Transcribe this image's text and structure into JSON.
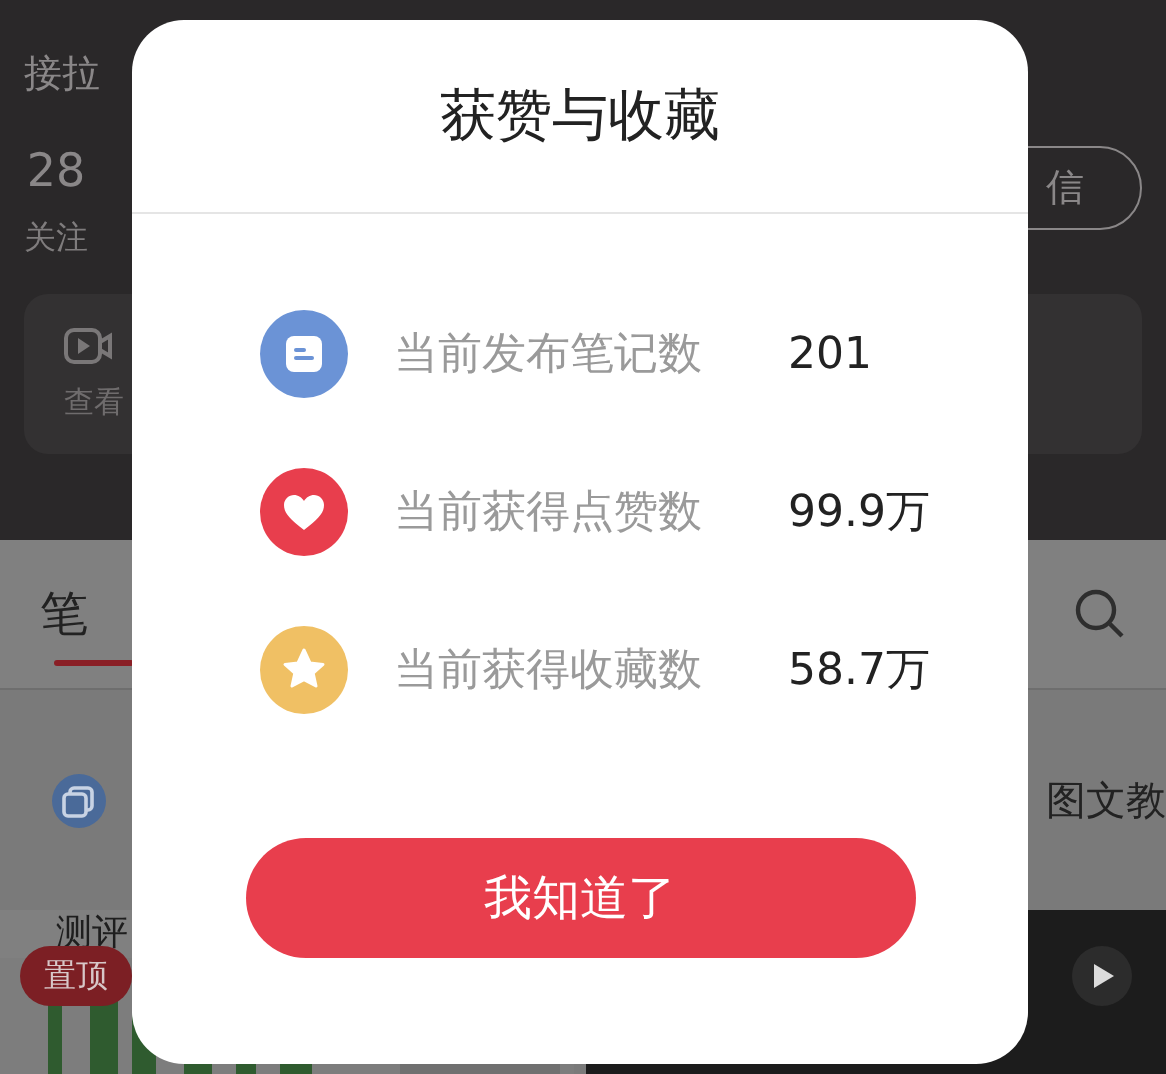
{
  "background": {
    "bio_lines": [
      "接拉"
    ],
    "stats": [
      {
        "value": "28",
        "label": "关注"
      }
    ],
    "message_button": "信",
    "video_card": {
      "label": "查看"
    },
    "tabs": [
      {
        "label": "笔",
        "selected": true
      }
    ],
    "collection_row": {
      "label": "图文教"
    },
    "notes": [
      {
        "kind": "picture",
        "title": "测评",
        "badge": "置顶"
      },
      {
        "kind": "video"
      }
    ]
  },
  "dialog": {
    "title": "获赞与收藏",
    "stats": [
      {
        "kind": "notes",
        "label": "当前发布笔记数",
        "value": "201",
        "color": "#6b93d6"
      },
      {
        "kind": "likes",
        "label": "当前获得点赞数",
        "value": "99.9万",
        "color": "#e83e4d"
      },
      {
        "kind": "collects",
        "label": "当前获得收藏数",
        "value": "58.7万",
        "color": "#f0c064"
      }
    ],
    "button": "我知道了"
  }
}
